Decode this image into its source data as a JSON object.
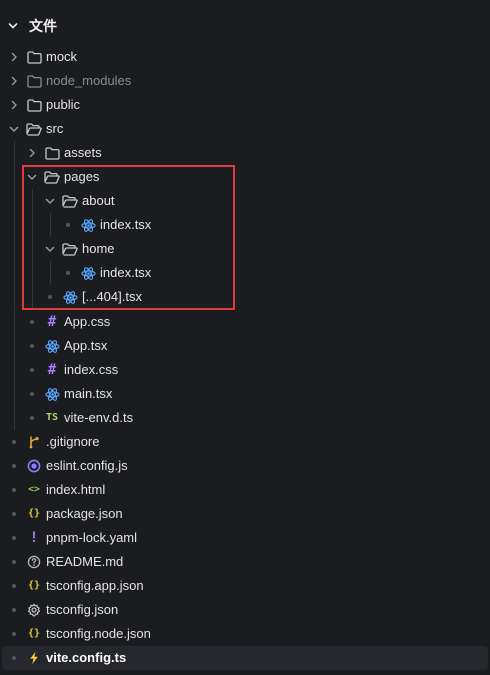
{
  "panel": {
    "title": "文件"
  },
  "colors": {
    "background": "#1b1c20",
    "folder": "#c8c8cc",
    "react": "#58a6ff",
    "css_hash": "#a77bff",
    "typescript": "#b5d56f",
    "json_braces": "#e2c744",
    "yaml": "#a77bff",
    "git": "#e8a33d",
    "eslint": "#8f7bff",
    "html": "#8bc34a",
    "vite": "#f7d038",
    "highlight_border": "#e03a3a",
    "selected_row": "#26272d"
  },
  "tree": {
    "mock": {
      "label": "mock",
      "icon": "folder-icon"
    },
    "node_modules": {
      "label": "node_modules",
      "icon": "folder-icon"
    },
    "public": {
      "label": "public",
      "icon": "folder-icon"
    },
    "src": {
      "label": "src",
      "icon": "folder-open-icon"
    },
    "assets": {
      "label": "assets",
      "icon": "folder-icon"
    },
    "pages": {
      "label": "pages",
      "icon": "folder-open-icon"
    },
    "about": {
      "label": "about",
      "icon": "folder-open-icon"
    },
    "about_index": {
      "label": "index.tsx",
      "icon": "react-icon"
    },
    "home": {
      "label": "home",
      "icon": "folder-open-icon"
    },
    "home_index": {
      "label": "index.tsx",
      "icon": "react-icon"
    },
    "not_found": {
      "label": "[...404].tsx",
      "icon": "react-icon"
    },
    "app_css": {
      "label": "App.css",
      "icon": "css-hash-icon"
    },
    "app_tsx": {
      "label": "App.tsx",
      "icon": "react-icon"
    },
    "index_css": {
      "label": "index.css",
      "icon": "css-hash-icon"
    },
    "main_tsx": {
      "label": "main.tsx",
      "icon": "react-icon"
    },
    "vite_env": {
      "label": "vite-env.d.ts",
      "icon": "typescript-icon",
      "glyph": "TS"
    },
    "gitignore": {
      "label": ".gitignore",
      "icon": "git-icon"
    },
    "eslint": {
      "label": "eslint.config.js",
      "icon": "eslint-icon"
    },
    "index_html": {
      "label": "index.html",
      "icon": "html-icon",
      "glyph": "<>"
    },
    "package_json": {
      "label": "package.json",
      "icon": "json-icon",
      "glyph": "{}"
    },
    "pnpm_lock": {
      "label": "pnpm-lock.yaml",
      "icon": "yaml-icon",
      "glyph": "!"
    },
    "readme": {
      "label": "README.md",
      "icon": "info-icon"
    },
    "tsconfig_app": {
      "label": "tsconfig.app.json",
      "icon": "json-icon",
      "glyph": "{}"
    },
    "tsconfig": {
      "label": "tsconfig.json",
      "icon": "gear-icon"
    },
    "tsconfig_node": {
      "label": "tsconfig.node.json",
      "icon": "json-icon",
      "glyph": "{}"
    },
    "vite_config": {
      "label": "vite.config.ts",
      "icon": "vite-icon"
    }
  }
}
